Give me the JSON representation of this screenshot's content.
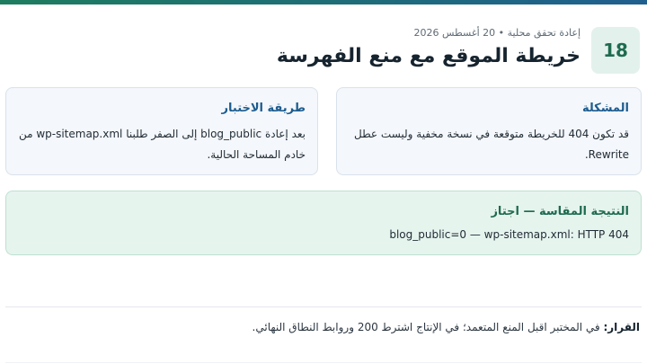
{
  "header": {
    "slide_number": "18",
    "meta": "إعادة تحقق محلية • 20 أغسطس 2026",
    "title": "خريطة الموقع مع منع الفهرسة"
  },
  "problem": {
    "heading": "المشكلة",
    "body": "قد تكون 404 للخريطة متوقعة في نسخة مخفية وليست عطل Rewrite."
  },
  "method": {
    "heading": "طريقة الاختبار",
    "body": "بعد إعادة blog_public إلى الصفر طلبنا wp-sitemap.xml من خادم المساحة الحالية."
  },
  "result": {
    "heading": "النتيجة المقاسة — اجتاز",
    "body": "blog_public=0 — wp-sitemap.xml: HTTP 404"
  },
  "decision": {
    "label": "القرار:",
    "text": "في المختبر اقبل المنع المتعمد؛ في الإنتاج اشترط 200 وروابط النطاق النهائي."
  },
  "colors": {
    "accent_green": "#1e6b50",
    "accent_blue": "#1c5c8f",
    "result_bg": "#e6f4ee",
    "card_bg": "#f4f7fb"
  }
}
